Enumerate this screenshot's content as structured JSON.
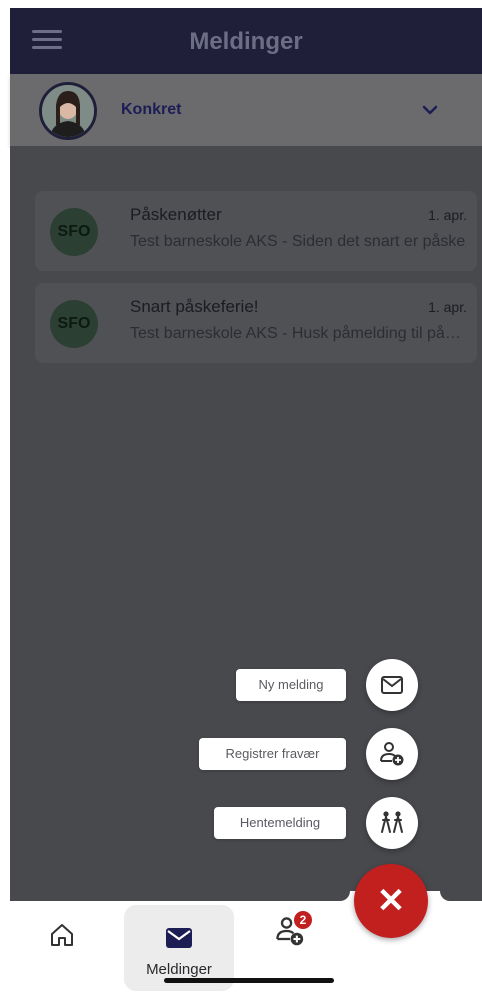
{
  "header": {
    "title": "Meldinger",
    "menu_icon": "hamburger-menu-icon"
  },
  "child_selector": {
    "name": "Konkret",
    "chevron_icon": "chevron-down-icon"
  },
  "messages": [
    {
      "avatar": "SFO",
      "subject": "Påskenøtter",
      "date": "1. apr.",
      "preview": "Test barneskole AKS - Siden det snart er påske"
    },
    {
      "avatar": "SFO",
      "subject": "Snart påskeferie!",
      "date": "1. apr.",
      "preview": "Test barneskole AKS - Husk påmelding til påskeferien"
    }
  ],
  "fab_actions": [
    {
      "label": "Ny melding",
      "icon": "envelope-icon"
    },
    {
      "label": "Registrer fravær",
      "icon": "person-add-icon"
    },
    {
      "label": "Hentemelding",
      "icon": "walking-people-icon"
    }
  ],
  "fab_close": {
    "symbol": "✕",
    "icon": "close-icon"
  },
  "bottom_nav": {
    "home_icon": "home-icon",
    "messages_label": "Meldinger",
    "messages_icon": "envelope-icon",
    "absence_icon": "person-add-icon",
    "absence_badge": "2"
  },
  "colors": {
    "header_bg": "#1f1f3a",
    "accent_red": "#c21f1f",
    "overlay_bg": "#48494d"
  }
}
